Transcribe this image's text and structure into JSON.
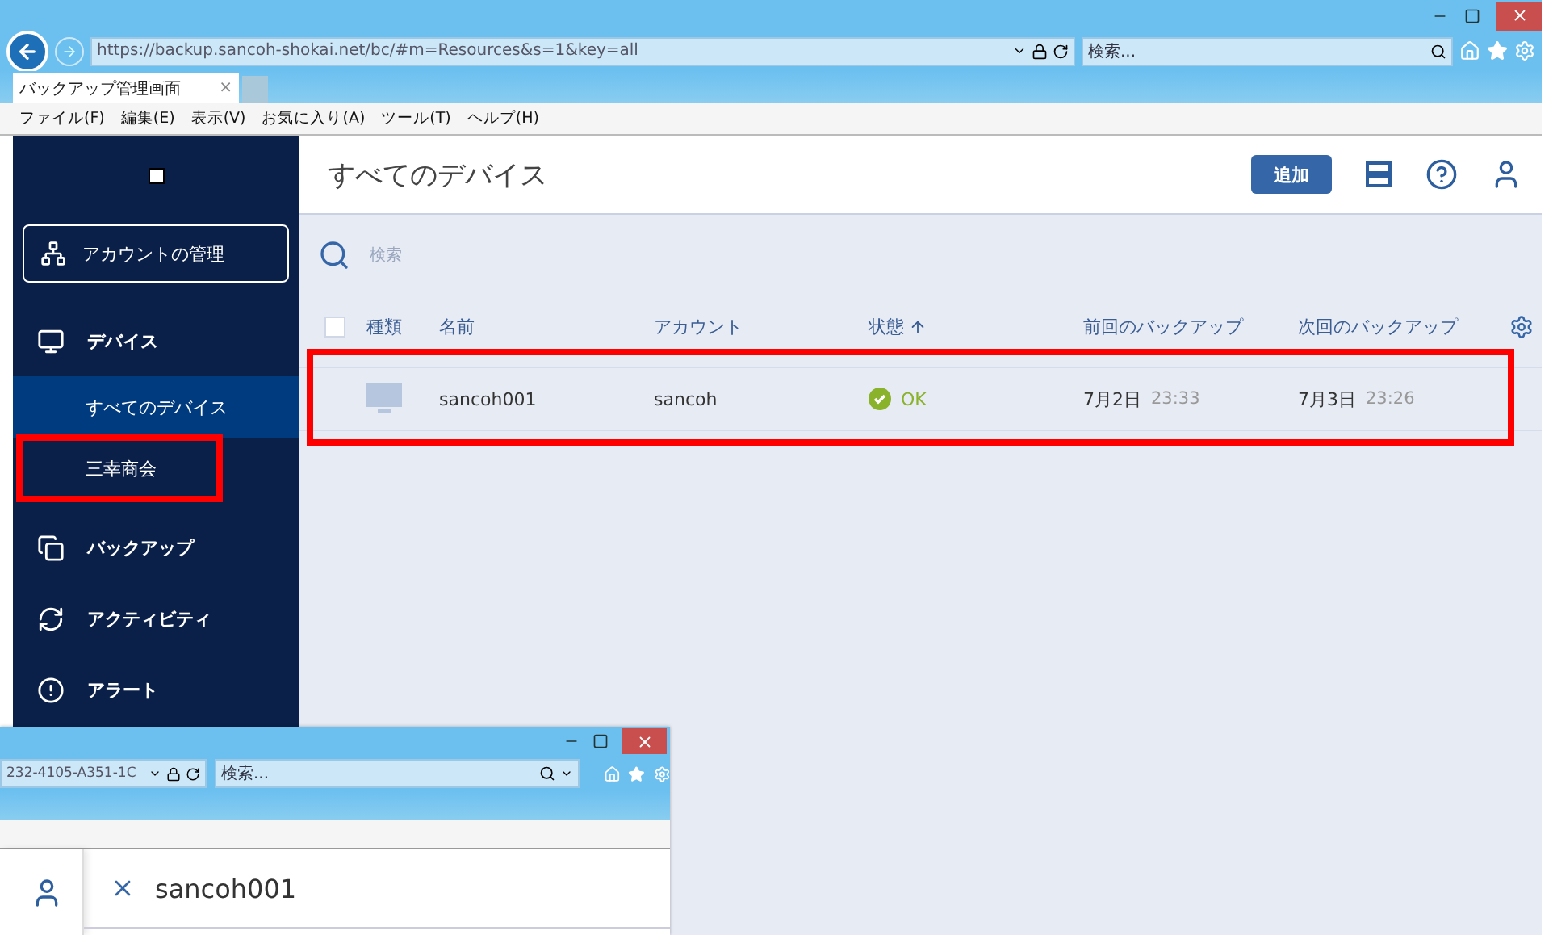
{
  "browser": {
    "url": "https://backup.sancoh-shokai.net/bc/#m=Resources&s=1&key=all",
    "search_placeholder": "検索...",
    "tab": {
      "title": "バックアップ管理画面",
      "close": "×"
    },
    "menu": [
      "ファイル(F)",
      "編集(E)",
      "表示(V)",
      "お気に入り(A)",
      "ツール(T)",
      "ヘルプ(H)"
    ]
  },
  "sidebar": {
    "account_button": "アカウントの管理",
    "items": [
      {
        "label": "デバイス",
        "kind": "section",
        "selected": false,
        "highlighted": false
      },
      {
        "label": "すべてのデバイス",
        "kind": "sub",
        "selected": true,
        "highlighted": false
      },
      {
        "label": "三幸商会",
        "kind": "sub",
        "selected": false,
        "highlighted": true
      },
      {
        "label": "バックアップ",
        "kind": "section",
        "selected": false,
        "highlighted": false
      },
      {
        "label": "アクティビティ",
        "kind": "section",
        "selected": false,
        "highlighted": false
      },
      {
        "label": "アラート",
        "kind": "section",
        "selected": false,
        "highlighted": false
      }
    ]
  },
  "page": {
    "title": "すべてのデバイス",
    "add_button": "追加",
    "search_placeholder": "検索",
    "table": {
      "select_all_checked": false,
      "columns": [
        {
          "label": "種類",
          "sorted": false
        },
        {
          "label": "名前",
          "sorted": false
        },
        {
          "label": "アカウント",
          "sorted": false
        },
        {
          "label": "状態",
          "sorted": true
        },
        {
          "label": "前回のバックアップ",
          "sorted": false
        },
        {
          "label": "次回のバックアップ",
          "sorted": false
        }
      ],
      "rows": [
        {
          "name": "sancoh001",
          "account": "sancoh",
          "status": {
            "kind": "ok",
            "label": "OK"
          },
          "last_backup": {
            "date": "7月2日",
            "time": "23:33"
          },
          "next_backup": {
            "date": "7月3日",
            "time": "23:26"
          },
          "highlighted": true
        }
      ]
    }
  },
  "second_window": {
    "url": "232-4105-A351-1C",
    "search_placeholder": "検索...",
    "panel_title": "sancoh001"
  }
}
